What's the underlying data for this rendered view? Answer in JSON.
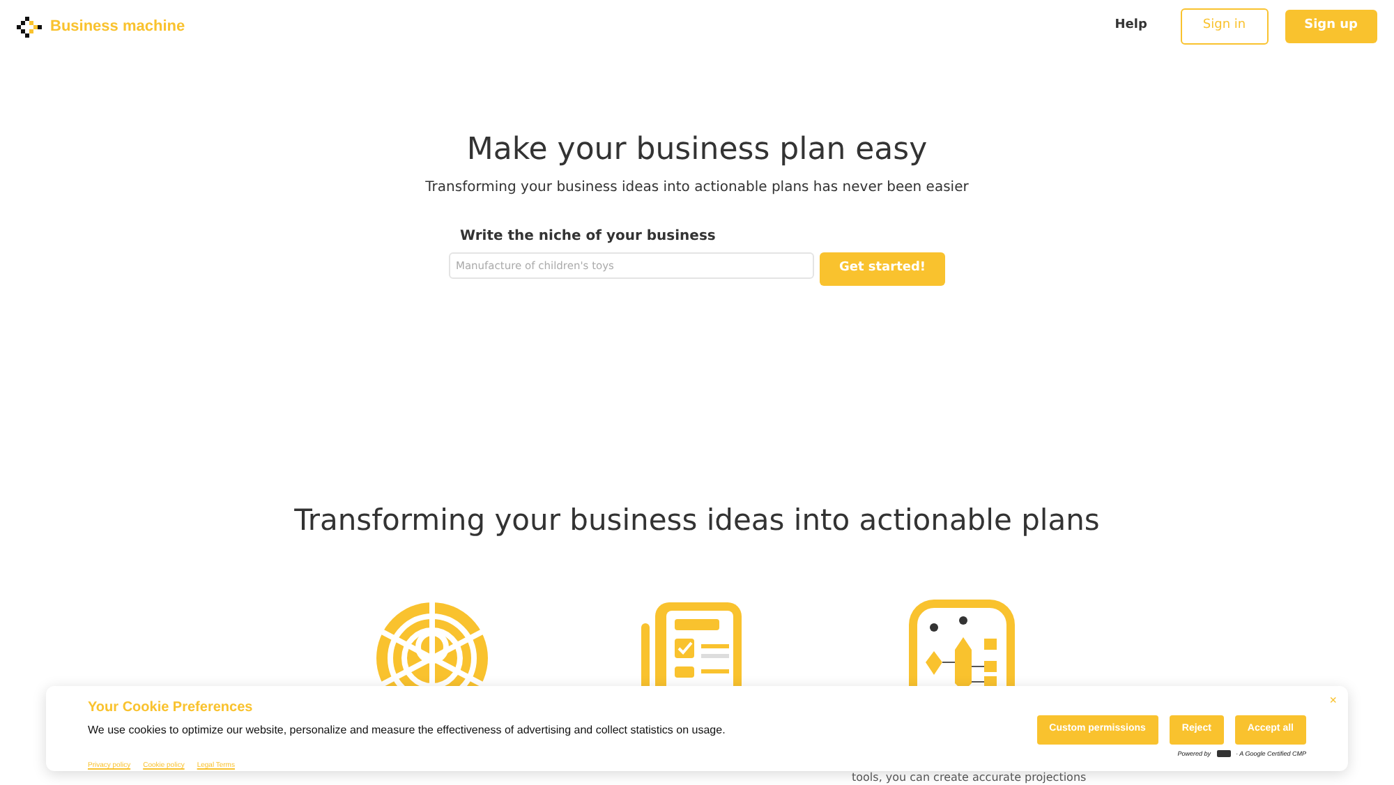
{
  "brand": {
    "name": "Business machine"
  },
  "nav": {
    "help": "Help",
    "sign_in": "Sign in",
    "sign_up": "Sign up"
  },
  "hero": {
    "title": "Make your business plan easy",
    "subtitle": "Transforming your business ideas into actionable plans has never been easier",
    "field_label": "Write the niche of your business",
    "placeholder": "Manufacture of children's toys",
    "button": "Get started!"
  },
  "features": {
    "title": "Transforming your business ideas into actionable plans",
    "items": [
      {
        "kind": "target"
      },
      {
        "kind": "checklist"
      },
      {
        "kind": "finance",
        "text": "tools, you can create accurate projections"
      }
    ]
  },
  "cookie_banner": {
    "title": "Your Cookie Preferences",
    "message": "We use cookies to optimize our website, personalize and measure the effectiveness of advertising and collect statistics on usage.",
    "links": [
      "Privacy policy",
      "Cookie policy",
      "Legal Terms"
    ],
    "buttons": [
      "Custom permissions",
      "Reject",
      "Accept all"
    ],
    "close": "×",
    "powered_by": "Powered by",
    "certified": "· A Google Certified CMP"
  }
}
